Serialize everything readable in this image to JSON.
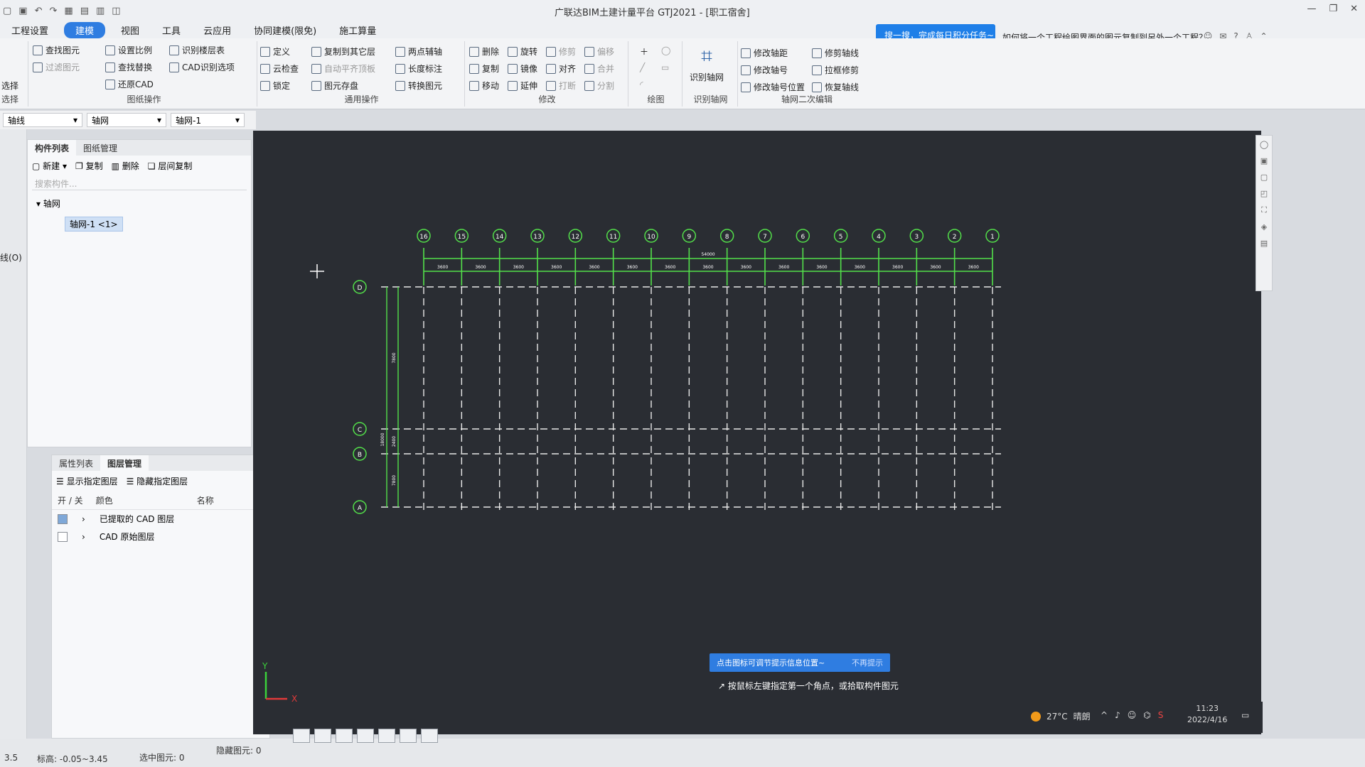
{
  "app": {
    "title": "广联达BIM土建计量平台 GTJ2021 - [职工宿舍]",
    "search_pill": "搜一搜，完成每日积分任务~",
    "help_question": "如何将一个工程绘图界面的图元复制到另外一个工程？"
  },
  "menu": {
    "items": [
      "工程设置",
      "建模",
      "视图",
      "工具",
      "云应用",
      "协同建模(限免)",
      "施工算量"
    ],
    "active": "建模"
  },
  "ribbon": {
    "select_group": {
      "items": [
        "选择"
      ],
      "label": "选择"
    },
    "drawing_ops": {
      "items": [
        "查找图元",
        "过滤图元",
        "设置比例",
        "查找替换",
        "还原CAD",
        "识别楼层表",
        "CAD识别选项"
      ],
      "label": "图纸操作"
    },
    "general_ops": {
      "items": [
        "定义",
        "云检查",
        "锁定",
        "复制到其它层",
        "自动平齐顶板",
        "图元存盘",
        "两点辅轴",
        "长度标注",
        "转换图元"
      ],
      "label": "通用操作"
    },
    "modify": {
      "items": [
        "删除",
        "旋转",
        "修剪",
        "偏移",
        "复制",
        "镜像",
        "对齐",
        "合并",
        "移动",
        "延伸",
        "打断",
        "分割"
      ],
      "label": "修改"
    },
    "draw": {
      "label": "绘图"
    },
    "recognize_grid": {
      "button": "识别轴网",
      "label": "识别轴网"
    },
    "grid_edit": {
      "items": [
        "修改轴距",
        "修改轴号",
        "修改轴号位置",
        "修剪轴线",
        "拉框修剪",
        "恢复轴线"
      ],
      "label": "轴网二次编辑"
    }
  },
  "selectors": [
    "轴线",
    "轴网",
    "轴网-1"
  ],
  "left_strip": {
    "label": "线(O)"
  },
  "component_panel": {
    "tabs": [
      "构件列表",
      "图纸管理"
    ],
    "tools": [
      "新建",
      "复制",
      "删除",
      "层间复制"
    ],
    "search_placeholder": "搜索构件...",
    "tree_root": "轴网",
    "tree_leaf": "轴网-1 <1>"
  },
  "layer_panel": {
    "tabs": [
      "属性列表",
      "图层管理"
    ],
    "tools": [
      "显示指定图层",
      "隐藏指定图层"
    ],
    "headers": [
      "开 / 关",
      "颜色",
      "名称"
    ],
    "rows": [
      {
        "name": "已提取的 CAD 图层",
        "on": true
      },
      {
        "name": "CAD 原始图层",
        "on": false
      }
    ]
  },
  "canvas": {
    "tip_text": "点击图标可调节提示信息位置~",
    "tip_dismiss": "不再提示",
    "command_text": "按鼠标左键指定第一个角点，或拾取构件图元",
    "top_axes": [
      "16",
      "15",
      "14",
      "13",
      "12",
      "11",
      "10",
      "9",
      "8",
      "7",
      "6",
      "5",
      "4",
      "3",
      "2",
      "1"
    ],
    "left_axes": [
      "D",
      "C",
      "B",
      "A"
    ],
    "top_spacing_labels": [
      "3600",
      "3600",
      "3600",
      "3600",
      "3600",
      "3600",
      "3600",
      "3600",
      "3600",
      "3600",
      "3600",
      "3600",
      "3600",
      "3600",
      "3600"
    ],
    "total_length_label": "54000",
    "left_dim_labels": [
      "7800",
      "2400",
      "7800"
    ],
    "left_total_label": "18000",
    "axis_x_label": "X",
    "axis_y_label": "Y"
  },
  "taskbar": {
    "temperature": "27°C",
    "weather": "晴朗",
    "time": "11:23",
    "date": "2022/4/16"
  },
  "status": {
    "elevation": "标高: -0.05~3.45",
    "selected": "选中图元: 0",
    "hidden": "隐藏图元: 0",
    "left_num": "3.5"
  },
  "colors": {
    "accent": "#2f7de1",
    "grid_green": "#53e04a",
    "canvas_bg": "#2a2d33"
  }
}
